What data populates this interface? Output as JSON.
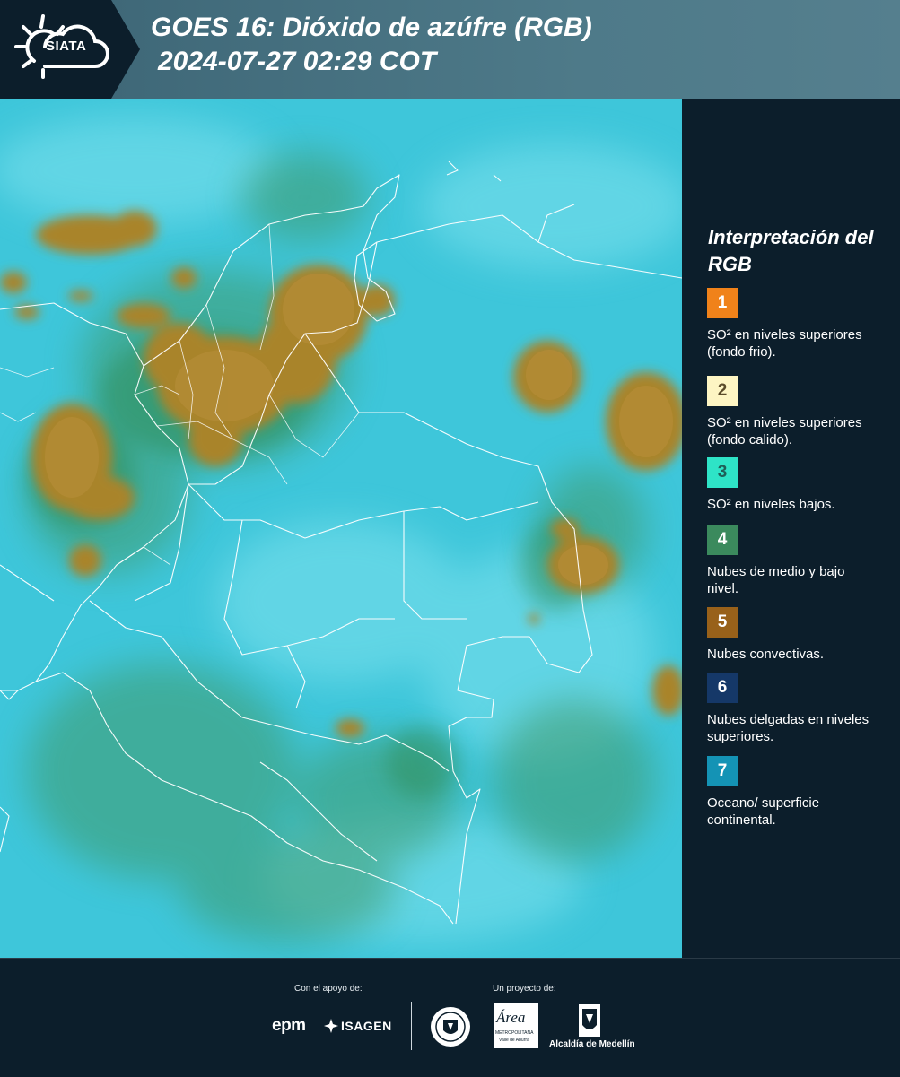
{
  "header": {
    "logo_text": "SIATA",
    "title_line1": "GOES 16: Dióxido de azúfre (RGB)",
    "title_line2": "2024-07-27 02:29 COT"
  },
  "legend": {
    "title": "Interpretación del RGB",
    "items": [
      {
        "number": "1",
        "label": "SO² en niveles superiores (fondo frio).",
        "color": "#f0821a",
        "text_color": "#ffffff"
      },
      {
        "number": "2",
        "label": "SO² en niveles superiores (fondo calido).",
        "color": "#fdf5c3",
        "text_color": "#5a4b2a"
      },
      {
        "number": "3",
        "label": "SO² en niveles bajos.",
        "color": "#2ee4c7",
        "text_color": "#1f5f58"
      },
      {
        "number": "4",
        "label": "Nubes de medio y bajo nivel.",
        "color": "#3b8a5d",
        "text_color": "#ffffff"
      },
      {
        "number": "5",
        "label": "Nubes convectivas.",
        "color": "#98611a",
        "text_color": "#ffffff"
      },
      {
        "number": "6",
        "label": "Nubes delgadas en niveles superiores.",
        "color": "#153868",
        "text_color": "#ffffff"
      },
      {
        "number": "7",
        "label": "Oceano/ superficie continental.",
        "color": "#1493b5",
        "text_color": "#ffffff"
      }
    ]
  },
  "footer": {
    "support_label": "Con el apoyo de:",
    "project_label": "Un proyecto de:",
    "sponsors": [
      "epm",
      "ISAGEN"
    ],
    "partners": [
      "Área Metropolitana Valle de Aburrá",
      "Alcaldía de Medellín"
    ],
    "area_logo_text": "Área",
    "area_logo_sub": "METROPOLITANA",
    "area_logo_sub2": "Valle de Aburrá",
    "alcaldia_text": "Alcaldía de Medellín"
  }
}
